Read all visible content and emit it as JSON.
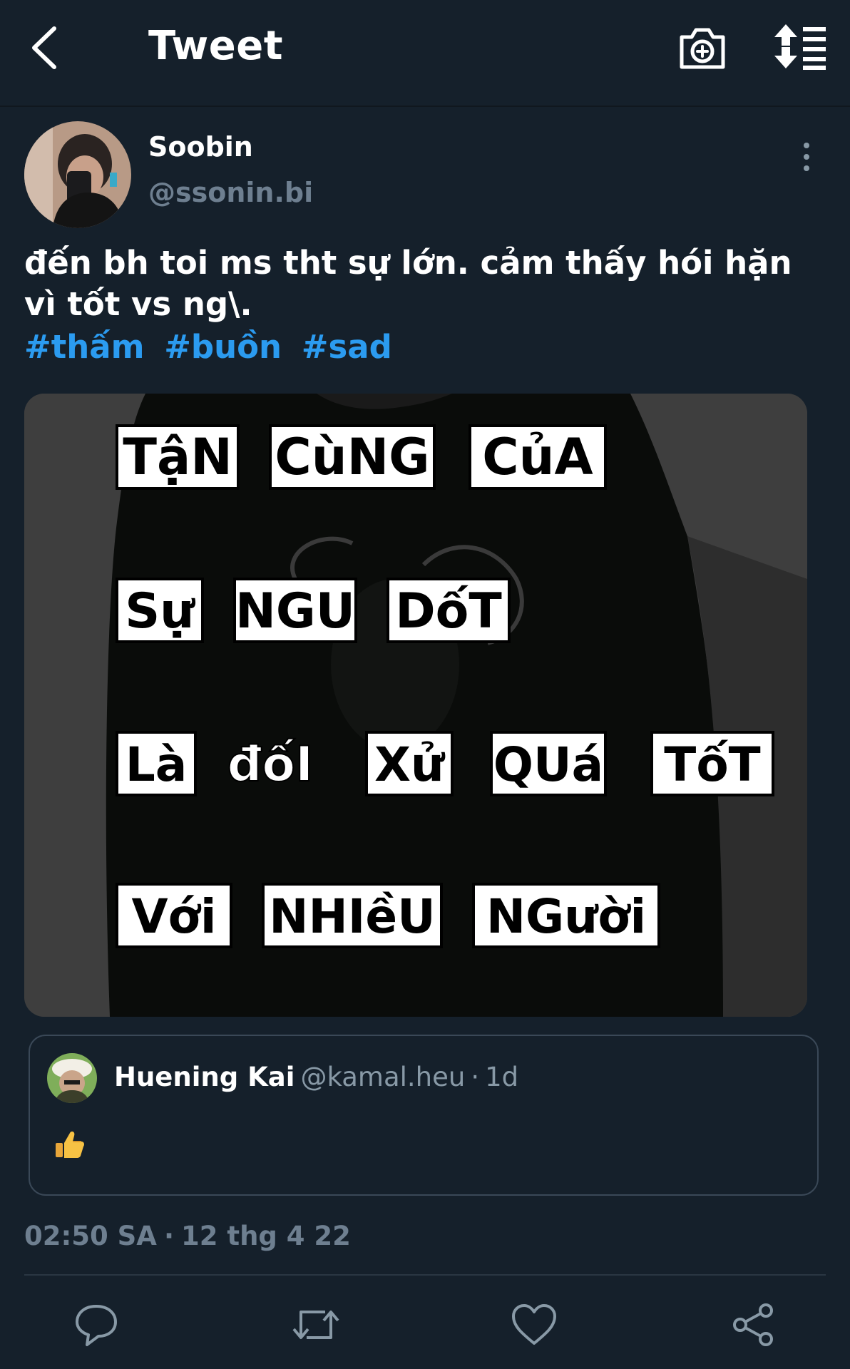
{
  "header": {
    "title": "Tweet",
    "back_icon": "chevron-left-icon",
    "camera_icon": "camera-plus-icon",
    "sort_icon": "sort-list-icon"
  },
  "author": {
    "name": "Soobin",
    "handle": "@ssonin.bi"
  },
  "tweet": {
    "text": "đến bh toi ms tht sự lớn. cảm thấy hói hặn vì tốt vs ng\\.",
    "hashtags": [
      "#thấm",
      "#buồn",
      "#sad"
    ]
  },
  "media": {
    "lines": [
      [
        "TậN",
        "CùNG",
        "CủA"
      ],
      [
        "Sự",
        "NGU",
        "DốT"
      ],
      [
        "Là",
        "đốI",
        "Xử",
        "QUá",
        "TốT"
      ],
      [
        "Với",
        "NHIềU",
        "NGười"
      ]
    ]
  },
  "quote": {
    "name": "Huening Kai",
    "handle": "@kamal.heu",
    "separator": "·",
    "time": "1d",
    "body_icon": "thumbs-up-emoji"
  },
  "meta": {
    "time": "02:50 SA",
    "separator": "·",
    "date": "12 thg 4 22"
  },
  "actions": [
    "reply-icon",
    "retweet-icon",
    "like-icon",
    "share-icon"
  ],
  "colors": {
    "background": "#15202b",
    "accent": "#2b9bf0",
    "secondary_text": "#6e7f90"
  }
}
